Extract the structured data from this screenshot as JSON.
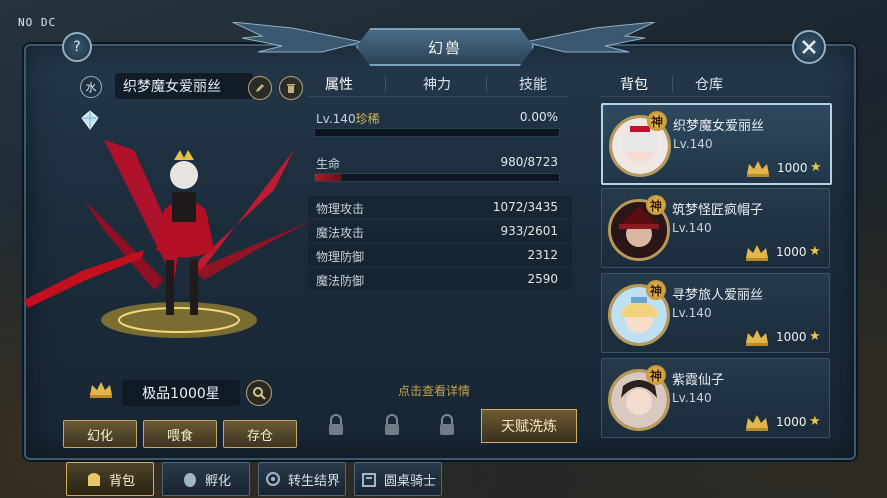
{
  "debug_text": "NO DC",
  "window": {
    "title": "幻兽"
  },
  "pet": {
    "element": "水",
    "name": "织梦魔女爱丽丝",
    "grade": "极品1000星"
  },
  "left_tabs": [
    {
      "label": "属性",
      "active": true
    },
    {
      "label": "神力",
      "active": false
    },
    {
      "label": "技能",
      "active": false
    }
  ],
  "stats": {
    "level_label": "Lv.140",
    "rarity": "珍稀",
    "exp_percent": "0.00%",
    "exp_fraction": 0.0,
    "hp_label": "生命",
    "hp_value": "980/8723",
    "hp_fraction": 0.112,
    "rows": [
      {
        "label": "物理攻击",
        "value": "1072/3435"
      },
      {
        "label": "魔法攻击",
        "value": "933/2601"
      },
      {
        "label": "物理防御",
        "value": "2312"
      },
      {
        "label": "魔法防御",
        "value": "2590"
      }
    ]
  },
  "detail_link": "点击查看详情",
  "talent_button": "天赋洗炼",
  "action_buttons": {
    "transform": "幻化",
    "feed": "喂食",
    "store": "存仓"
  },
  "right_tabs": [
    {
      "label": "背包",
      "active": true
    },
    {
      "label": "仓库",
      "active": false
    }
  ],
  "pet_list": [
    {
      "name": "织梦魔女爱丽丝",
      "level": "Lv.140",
      "stars": "1000",
      "badge": "神",
      "selected": true
    },
    {
      "name": "筑梦怪匠疯帽子",
      "level": "Lv.140",
      "stars": "1000",
      "badge": "神",
      "selected": false
    },
    {
      "name": "寻梦旅人爱丽丝",
      "level": "Lv.140",
      "stars": "1000",
      "badge": "神",
      "selected": false
    },
    {
      "name": "紫霞仙子",
      "level": "Lv.140",
      "stars": "1000",
      "badge": "神",
      "selected": false
    }
  ],
  "bottom_nav": [
    {
      "label": "背包",
      "active": true
    },
    {
      "label": "孵化",
      "active": false
    },
    {
      "label": "转生结界",
      "active": false
    },
    {
      "label": "圆桌骑士",
      "active": false
    }
  ],
  "colors": {
    "accent_gold": "#d1ae5e",
    "hp_red": "#b01d28",
    "frame_blue": "#3e5a70"
  }
}
